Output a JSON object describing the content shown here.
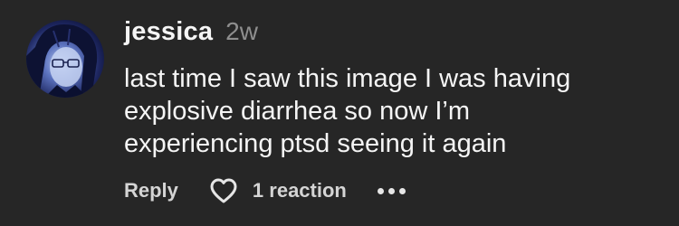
{
  "comment": {
    "username": "jessica",
    "timestamp": "2w",
    "body_lines": [
      "last time I saw this image I was having",
      "explosive diarrhea so now I’m",
      "experiencing ptsd seeing it again"
    ],
    "actions": {
      "reply_label": "Reply",
      "reaction_label": "1 reaction",
      "more_icon": "more-horizontal-icon",
      "heart_icon": "heart-outline-icon"
    }
  },
  "colors": {
    "background": "#262626",
    "text_primary": "#f5f5f5",
    "text_secondary": "#8e8e8e"
  }
}
